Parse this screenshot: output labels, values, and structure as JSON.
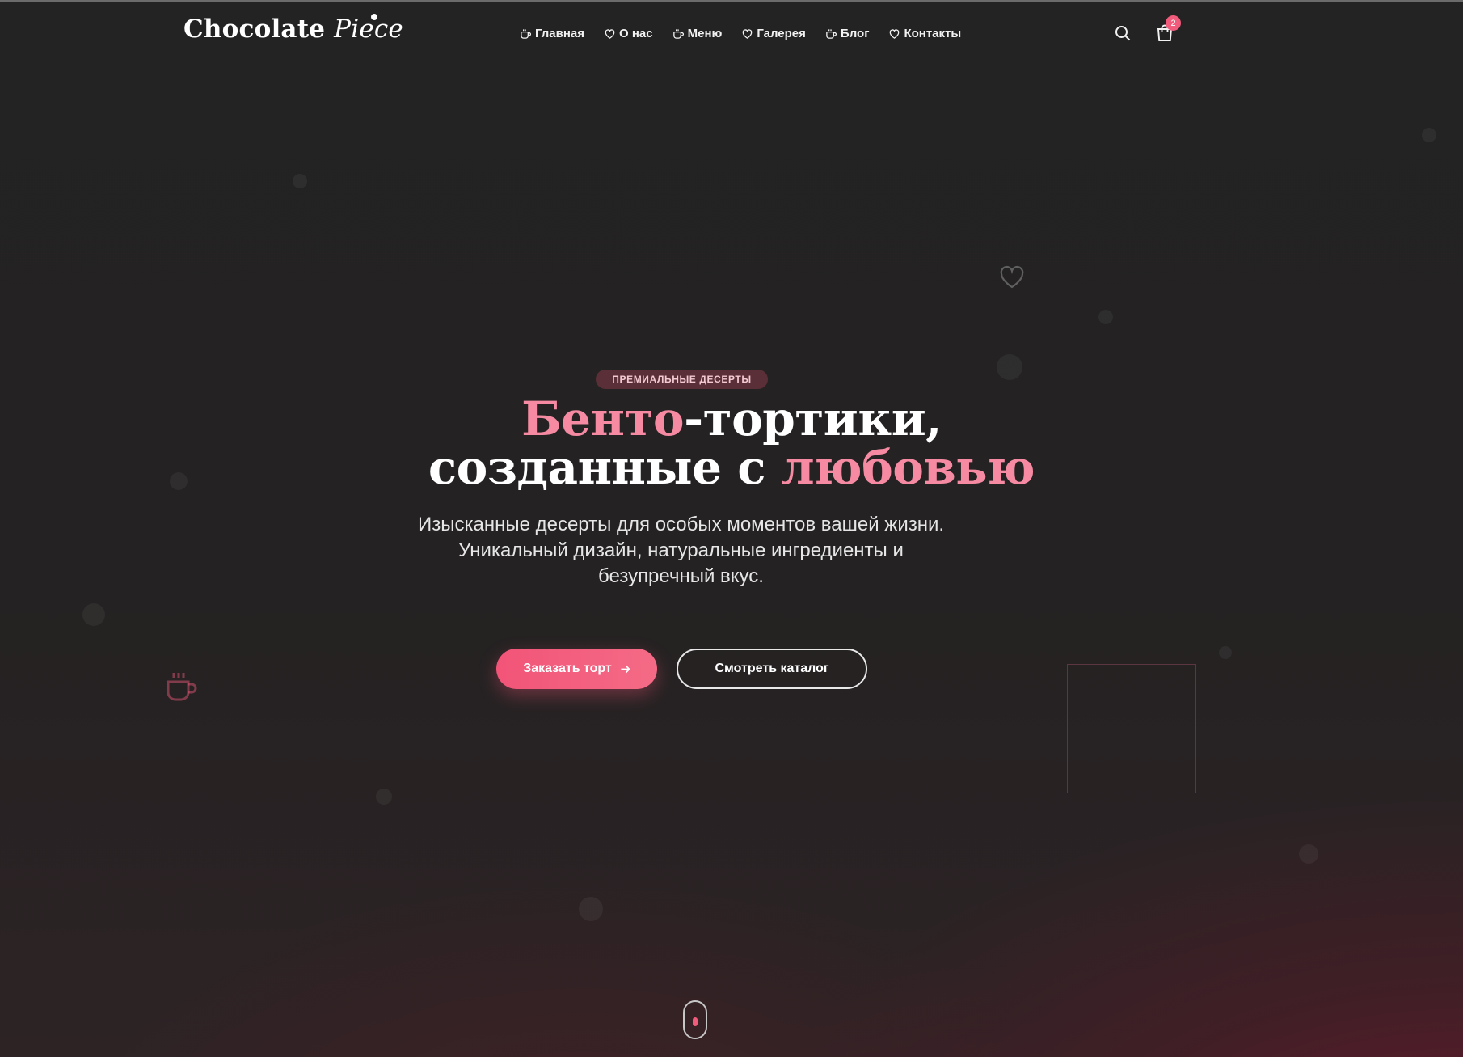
{
  "header": {
    "logo_main": "Chocolate",
    "logo_italic": "Piece",
    "nav": [
      {
        "label": "Главная",
        "icon": "cup-icon"
      },
      {
        "label": "О нас",
        "icon": "heart-icon"
      },
      {
        "label": "Меню",
        "icon": "cup-icon"
      },
      {
        "label": "Галерея",
        "icon": "heart-icon"
      },
      {
        "label": "Блог",
        "icon": "cup-icon"
      },
      {
        "label": "Контакты",
        "icon": "heart-icon"
      }
    ],
    "search_icon": "search-icon",
    "cart_icon": "shopping-bag-icon",
    "cart_count": "2"
  },
  "hero": {
    "badge": "ПРЕМИАЛЬНЫЕ ДЕСЕРТЫ",
    "title_accent_1": "Бенто",
    "title_part_1": "-тортики,",
    "title_part_2": "созданные с ",
    "title_accent_2": "любовью",
    "subtitle_line_1": "Изысканные десерты для особых моментов вашей жизни.",
    "subtitle_line_2": "Уникальный дизайн, натуральные ингредиенты и безупречный вкус.",
    "primary_button": "Заказать торт",
    "primary_button_icon": "arrow-right-icon",
    "secondary_button": "Смотреть каталог"
  },
  "colors": {
    "accent": "#f58aa2",
    "button": "#f25478",
    "background": "#232323"
  }
}
